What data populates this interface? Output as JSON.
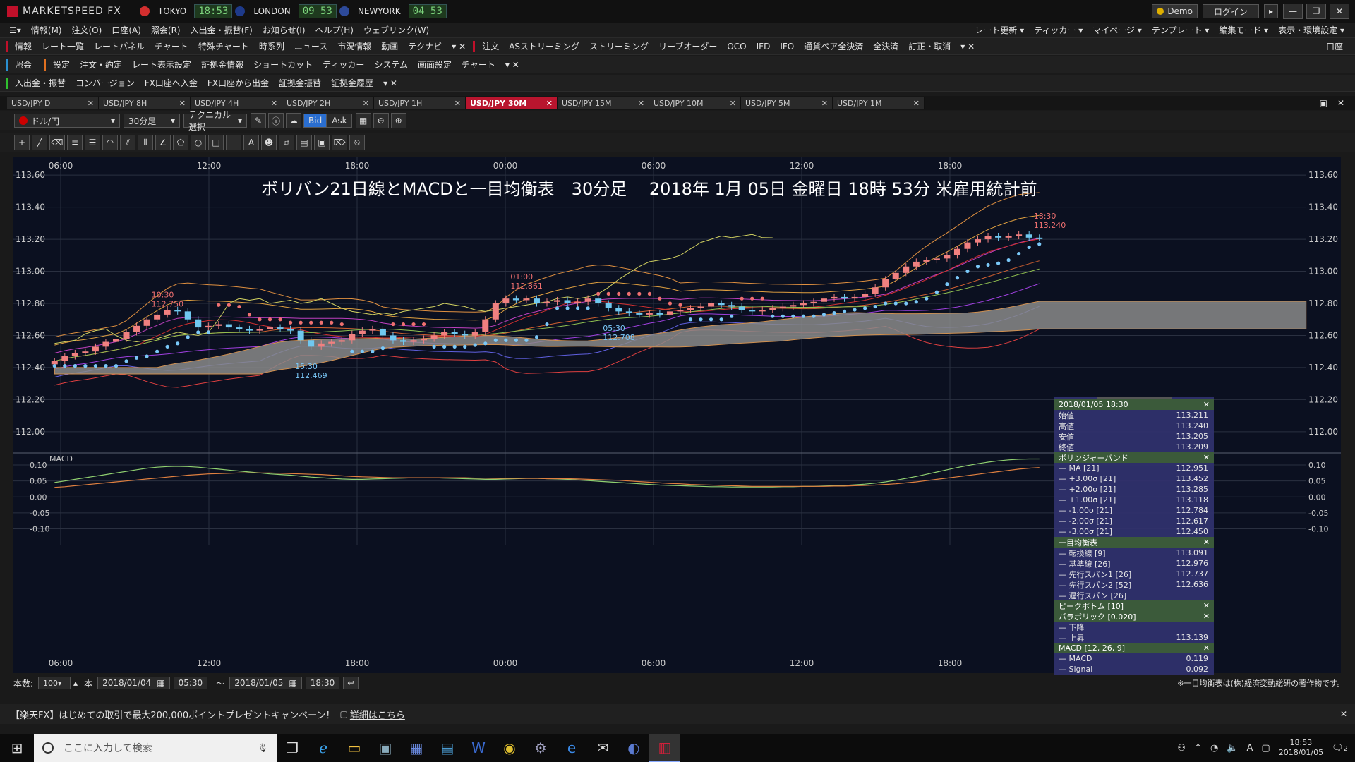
{
  "app": {
    "title": "MARKETSPEED FX"
  },
  "clocks": [
    {
      "city": "TOKYO",
      "time": "18:53",
      "flag_color": "#d32f2f"
    },
    {
      "city": "LONDON",
      "time": "09 53",
      "flag_color": "#1e3a8a"
    },
    {
      "city": "NEWYORK",
      "time": "04 53",
      "flag_color": "#2d4a9a"
    }
  ],
  "titlebar_right": {
    "demo": "Demo",
    "login": "ログイン"
  },
  "menu": [
    "情報(M)",
    "注文(O)",
    "口座(A)",
    "照会(R)",
    "入出金・振替(F)",
    "お知らせ(I)",
    "ヘルプ(H)",
    "ウェブリンク(W)"
  ],
  "menu_right": [
    "レート更新",
    "ティッカー",
    "マイページ",
    "テンプレート",
    "編集モード",
    "表示・環境設定"
  ],
  "toolbar1": {
    "label": "情報",
    "items": [
      "レート一覧",
      "レートパネル",
      "チャート",
      "特殊チャート",
      "時系列",
      "ニュース",
      "市況情報",
      "動画",
      "テクナビ"
    ],
    "label2": "注文",
    "items2": [
      "ASストリーミング",
      "ストリーミング",
      "リーブオーダー",
      "OCO",
      "IFD",
      "IFO",
      "通貨ペア全決済",
      "全決済",
      "訂正・取消"
    ],
    "right": "口座"
  },
  "toolbar2": {
    "label": "照会",
    "label2": "設定",
    "items": [
      "注文・約定",
      "レート表示設定",
      "証拠金情報",
      "ショートカット",
      "ティッカー",
      "システム",
      "画面設定",
      "チャート"
    ]
  },
  "toolbar3": {
    "label": "入出金・振替",
    "items": [
      "コンバージョン",
      "FX口座へ入金",
      "FX口座から出金",
      "証拠金振替",
      "証拠金履歴"
    ]
  },
  "chart_tabs": [
    {
      "label": "USD/JPY D",
      "active": false
    },
    {
      "label": "USD/JPY 8H",
      "active": false
    },
    {
      "label": "USD/JPY 4H",
      "active": false
    },
    {
      "label": "USD/JPY 2H",
      "active": false
    },
    {
      "label": "USD/JPY 1H",
      "active": false
    },
    {
      "label": "USD/JPY 30M",
      "active": true
    },
    {
      "label": "USD/JPY 15M",
      "active": false
    },
    {
      "label": "USD/JPY 10M",
      "active": false
    },
    {
      "label": "USD/JPY 5M",
      "active": false
    },
    {
      "label": "USD/JPY 1M",
      "active": false
    }
  ],
  "chart_toolbar": {
    "pair": "ドル/円",
    "period": "30分足",
    "technical": "テクニカル選択",
    "bid": "Bid",
    "ask": "Ask"
  },
  "chart_data": {
    "type": "candlestick",
    "title": "ボリバン21日線とMACDと一目均衡表　30分足　 2018年 1月 05日 金曜日 18時 53分 米雇用統計前",
    "x_labels": [
      "06:00",
      "12:00",
      "18:00",
      "00:00",
      "06:00",
      "12:00",
      "18:00"
    ],
    "y_ticks": [
      113.6,
      113.4,
      113.2,
      113.0,
      112.8,
      112.6,
      112.4,
      112.2,
      112.0
    ],
    "ylim": [
      111.92,
      113.68
    ],
    "n_bars": 97,
    "candles_close": [
      112.44,
      112.47,
      112.49,
      112.5,
      112.53,
      112.56,
      112.58,
      112.62,
      112.66,
      112.7,
      112.73,
      112.76,
      112.75,
      112.7,
      112.65,
      112.66,
      112.67,
      112.65,
      112.64,
      112.63,
      112.64,
      112.65,
      112.64,
      112.63,
      112.57,
      112.53,
      112.55,
      112.56,
      112.57,
      112.61,
      112.63,
      112.64,
      112.6,
      112.57,
      112.56,
      112.57,
      112.58,
      112.6,
      112.62,
      112.61,
      112.6,
      112.62,
      112.7,
      112.8,
      112.83,
      112.82,
      112.83,
      112.8,
      112.81,
      112.82,
      112.8,
      112.81,
      112.83,
      112.8,
      112.77,
      112.75,
      112.74,
      112.73,
      112.74,
      112.73,
      112.75,
      112.76,
      112.77,
      112.78,
      112.8,
      112.79,
      112.78,
      112.76,
      112.75,
      112.76,
      112.77,
      112.78,
      112.79,
      112.8,
      112.81,
      112.83,
      112.84,
      112.83,
      112.84,
      112.86,
      112.9,
      112.95,
      112.99,
      113.03,
      113.06,
      113.07,
      113.08,
      113.1,
      113.14,
      113.18,
      113.2,
      113.22,
      113.21,
      113.22,
      113.23,
      113.21,
      113.209
    ],
    "annotations": [
      {
        "time": "10:30",
        "price": "112.750"
      },
      {
        "time": "15:30",
        "price": "112.469"
      },
      {
        "time": "01:00",
        "price": "112.861"
      },
      {
        "time": "05:30",
        "price": "112.708"
      },
      {
        "time": "18:30",
        "price": "113.240"
      }
    ],
    "macd": {
      "label": "MACD",
      "y_ticks": [
        0.1,
        0.05,
        0.0,
        -0.05,
        -0.1
      ],
      "ylim": [
        -0.11,
        0.12
      ],
      "macd": [
        0.045,
        0.05,
        0.055,
        0.06,
        0.065,
        0.07,
        0.075,
        0.08,
        0.085,
        0.09,
        0.093,
        0.095,
        0.096,
        0.095,
        0.093,
        0.09,
        0.087,
        0.084,
        0.081,
        0.078,
        0.075,
        0.072,
        0.07,
        0.068,
        0.065,
        0.062,
        0.06,
        0.058,
        0.056,
        0.055,
        0.055,
        0.056,
        0.057,
        0.058,
        0.059,
        0.06,
        0.06,
        0.06,
        0.059,
        0.058,
        0.057,
        0.056,
        0.055,
        0.055,
        0.056,
        0.057,
        0.058,
        0.058,
        0.057,
        0.056,
        0.055,
        0.053,
        0.051,
        0.049,
        0.047,
        0.045,
        0.043,
        0.041,
        0.039,
        0.037,
        0.036,
        0.035,
        0.034,
        0.033,
        0.032,
        0.032,
        0.031,
        0.031,
        0.031,
        0.031,
        0.031,
        0.032,
        0.032,
        0.033,
        0.033,
        0.034,
        0.035,
        0.036,
        0.038,
        0.04,
        0.043,
        0.047,
        0.052,
        0.058,
        0.064,
        0.071,
        0.078,
        0.085,
        0.092,
        0.098,
        0.104,
        0.109,
        0.113,
        0.116,
        0.118,
        0.119,
        0.119
      ],
      "signal": [
        0.03,
        0.032,
        0.035,
        0.038,
        0.041,
        0.044,
        0.047,
        0.05,
        0.053,
        0.056,
        0.059,
        0.062,
        0.065,
        0.068,
        0.07,
        0.072,
        0.073,
        0.074,
        0.075,
        0.075,
        0.075,
        0.075,
        0.074,
        0.073,
        0.072,
        0.071,
        0.07,
        0.068,
        0.066,
        0.064,
        0.063,
        0.062,
        0.061,
        0.06,
        0.06,
        0.06,
        0.06,
        0.06,
        0.06,
        0.06,
        0.06,
        0.059,
        0.059,
        0.058,
        0.058,
        0.058,
        0.058,
        0.058,
        0.057,
        0.057,
        0.057,
        0.056,
        0.055,
        0.054,
        0.053,
        0.052,
        0.05,
        0.048,
        0.046,
        0.044,
        0.042,
        0.041,
        0.039,
        0.038,
        0.037,
        0.036,
        0.035,
        0.034,
        0.033,
        0.033,
        0.033,
        0.033,
        0.033,
        0.033,
        0.033,
        0.033,
        0.034,
        0.034,
        0.035,
        0.036,
        0.037,
        0.039,
        0.041,
        0.044,
        0.047,
        0.051,
        0.055,
        0.059,
        0.063,
        0.067,
        0.071,
        0.075,
        0.079,
        0.083,
        0.087,
        0.09,
        0.092
      ]
    }
  },
  "bottombar": {
    "count_label": "本数:",
    "count": "100",
    "unit": "本",
    "from_date": "2018/01/04",
    "from_time": "05:30",
    "tilde": "～",
    "to_date": "2018/01/05",
    "to_time": "18:30",
    "note": "※一目均衡表は(株)経済変動総研の著作物です。"
  },
  "info_panel": {
    "header": "2018/01/05 18:30",
    "ohlc": [
      [
        "始値",
        "113.211"
      ],
      [
        "高値",
        "113.240"
      ],
      [
        "安値",
        "113.205"
      ],
      [
        "終値",
        "113.209"
      ]
    ],
    "boll_header": "ボリンジャーバンド",
    "boll": [
      [
        "MA [21]",
        "112.951",
        "#d08040"
      ],
      [
        "+3.00σ [21]",
        "113.452",
        "#e0a040"
      ],
      [
        "+2.00σ [21]",
        "113.285",
        "#e0a040"
      ],
      [
        "+1.00σ [21]",
        "113.118",
        "#c040c0"
      ],
      [
        "-1.00σ [21]",
        "112.784",
        "#a040e0"
      ],
      [
        "-2.00σ [21]",
        "112.617",
        "#6060e0"
      ],
      [
        "-3.00σ [21]",
        "112.450",
        "#e04040"
      ]
    ],
    "ichi_header": "一目均衡表",
    "ichi": [
      [
        "転換線 [9]",
        "113.091",
        "#c04040"
      ],
      [
        "基準線 [26]",
        "112.976",
        "#a0d060"
      ],
      [
        "先行スパン1 [26]",
        "112.737",
        "#c0c060"
      ],
      [
        "先行スパン2 [52]",
        "112.636",
        "#d08040"
      ],
      [
        "遅行スパン [26]",
        "",
        "#d0d060"
      ]
    ],
    "peak_header": "ピークボトム [10]",
    "para_header": "パラボリック [0.020]",
    "para": [
      [
        "下降",
        ""
      ],
      [
        "上昇",
        "113.139"
      ]
    ],
    "macd_header": "MACD [12, 26, 9]",
    "macd": [
      [
        "MACD",
        "0.119"
      ],
      [
        "Signal",
        "0.092"
      ]
    ]
  },
  "ad": {
    "text": "【楽天FX】はじめての取引で最大200,000ポイントプレゼントキャンペーン！",
    "link": "詳細はこちら"
  },
  "taskbar": {
    "search_placeholder": "ここに入力して検索",
    "time": "18:53",
    "date": "2018/01/05",
    "ime": "A",
    "notifications": "2"
  }
}
